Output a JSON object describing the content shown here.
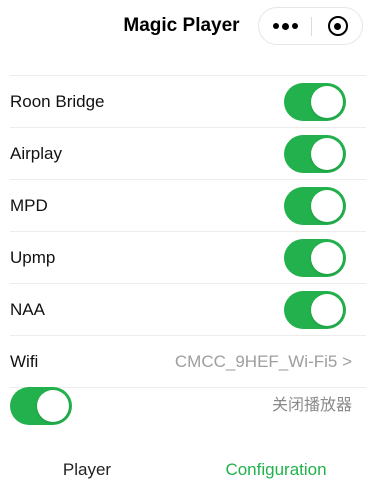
{
  "header": {
    "title": "Magic Player",
    "more_icon": "more-dots-icon",
    "close_icon": "close-target-icon"
  },
  "settings": [
    {
      "label": "Roon Bridge",
      "enabled": true
    },
    {
      "label": "Airplay",
      "enabled": true
    },
    {
      "label": "MPD",
      "enabled": true
    },
    {
      "label": "Upmp",
      "enabled": true
    },
    {
      "label": "NAA",
      "enabled": true
    }
  ],
  "wifi": {
    "label": "Wifi",
    "value": "CMCC_9HEF_Wi-Fi5 >"
  },
  "player_control": {
    "enabled": true,
    "stop_label": "关闭播放器"
  },
  "tabs": [
    {
      "label": "Player",
      "active": false
    },
    {
      "label": "Configuration",
      "active": true
    }
  ],
  "colors": {
    "accent": "#22b14c",
    "toggle_on": "#22b14c",
    "muted_text": "#9e9e9e"
  }
}
